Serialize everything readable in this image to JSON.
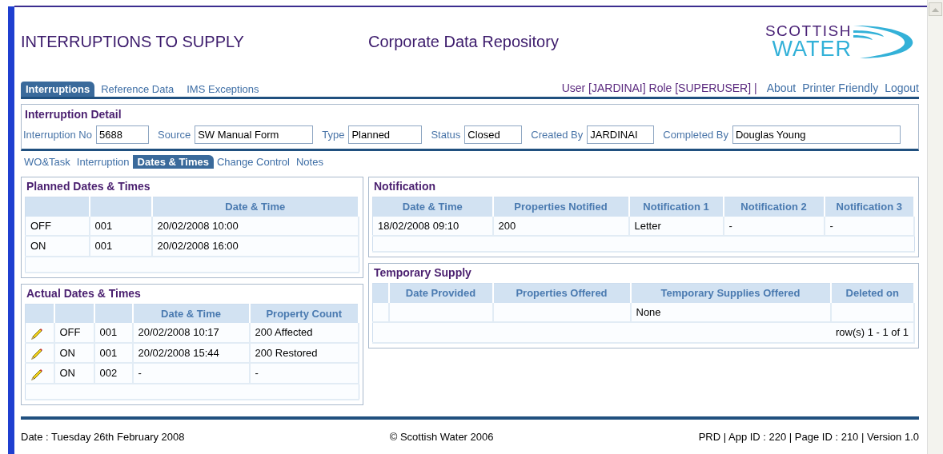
{
  "header": {
    "title": "INTERRUPTIONS TO SUPPLY",
    "subtitle": "Corporate Data Repository",
    "logo": {
      "line1": "SCOTTISH",
      "line2": "WATER"
    }
  },
  "nav_tabs": [
    {
      "label": "Interruptions",
      "selected": true
    },
    {
      "label": "Reference Data",
      "selected": false
    },
    {
      "label": "IMS Exceptions",
      "selected": false
    }
  ],
  "user_info": "User [JARDINAI] Role [SUPERUSER] |",
  "links": [
    "About",
    "Printer Friendly",
    "Logout"
  ],
  "detail": {
    "title": "Interruption Detail",
    "fields": [
      {
        "label": "Interruption No",
        "value": "5688"
      },
      {
        "label": "Source",
        "value": "SW Manual Form"
      },
      {
        "label": "Type",
        "value": "Planned"
      },
      {
        "label": "Status",
        "value": "Closed"
      },
      {
        "label": "Created By",
        "value": "JARDINAI"
      },
      {
        "label": "Completed By",
        "value": "Douglas Young"
      }
    ]
  },
  "sub_tabs": [
    {
      "label": "WO&Task",
      "selected": false
    },
    {
      "label": "Interruption",
      "selected": false
    },
    {
      "label": "Dates & Times",
      "selected": true
    },
    {
      "label": "Change Control",
      "selected": false
    },
    {
      "label": "Notes",
      "selected": false
    }
  ],
  "planned": {
    "title": "Planned Dates & Times",
    "columns": [
      null,
      null,
      "Date & Time"
    ],
    "rows": [
      {
        "cells": [
          "OFF",
          "001",
          "20/02/2008 10:00"
        ]
      },
      {
        "cells": [
          "ON",
          "001",
          "20/02/2008 16:00"
        ]
      }
    ]
  },
  "actual": {
    "title": "Actual Dates & Times",
    "columns": [
      null,
      null,
      "Date & Time",
      "Property Count"
    ],
    "rows": [
      {
        "editable": true,
        "cells": [
          "OFF",
          "001",
          "20/02/2008 10:17",
          "200 Affected"
        ]
      },
      {
        "editable": true,
        "cells": [
          "ON",
          "001",
          "20/02/2008 15:44",
          "200 Restored"
        ]
      },
      {
        "editable": true,
        "cells": [
          "ON",
          "002",
          "-",
          "-"
        ]
      }
    ]
  },
  "notification": {
    "title": "Notification",
    "columns": [
      "Date & Time",
      "Properties Notified",
      "Notification 1",
      "Notification 2",
      "Notification 3"
    ],
    "rows": [
      {
        "cells": [
          "18/02/2008 09:10",
          "200",
          "Letter",
          "-",
          "-"
        ]
      }
    ]
  },
  "temporary_supply": {
    "title": "Temporary Supply",
    "columns": [
      null,
      "Date Provided",
      "Properties Offered",
      "Temporary Supplies Offered",
      "Deleted on"
    ],
    "rows": [
      {
        "cells": [
          null,
          null,
          null,
          "None",
          null
        ]
      }
    ],
    "pager": "row(s) 1 - 1 of 1"
  },
  "footer": {
    "date": "Date : Tuesday 26th February 2008",
    "copyright": "© Scottish Water 2006",
    "version": "PRD | App ID : 220 | Page ID : 210 | Version 1.0"
  }
}
